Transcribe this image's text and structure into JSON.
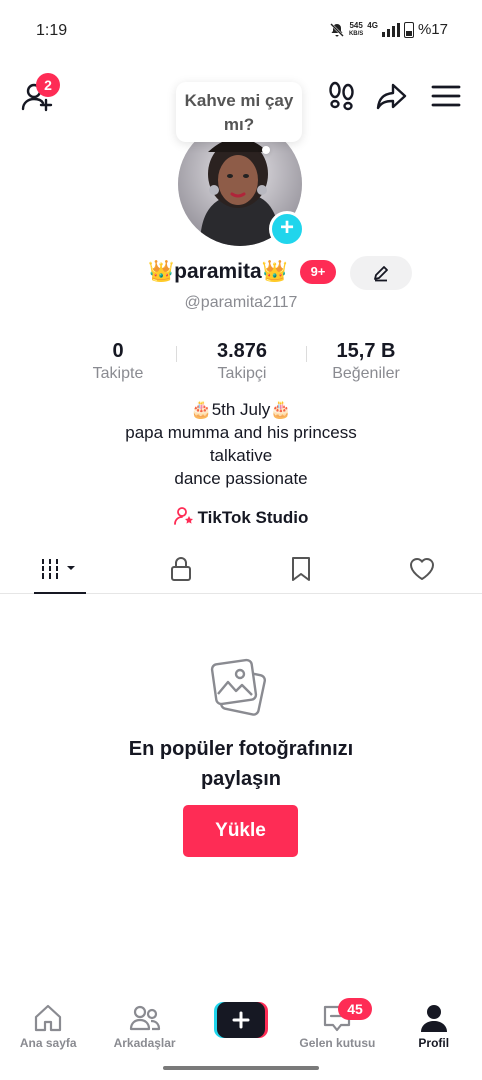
{
  "status": {
    "time": "1:19",
    "speed_value": "545",
    "speed_unit": "KB/S",
    "network": "4G",
    "battery": "%17"
  },
  "header": {
    "friends_badge": "2"
  },
  "bubble": {
    "text": "Kahve mi çay mı?"
  },
  "profile": {
    "name": "👑paramita👑",
    "name_badge": "9+",
    "handle": "@paramita2117"
  },
  "stats": [
    {
      "value": "0",
      "label": "Takipte"
    },
    {
      "value": "3.876",
      "label": "Takipçi"
    },
    {
      "value": "15,7 B",
      "label": "Beğeniler"
    }
  ],
  "bio": {
    "line1": "🎂5th July🎂",
    "line2": "papa mumma and his princess",
    "line3": "talkative",
    "line4": "dance passionate"
  },
  "studio_label": "TikTok Studio",
  "empty": {
    "title": "En popüler fotoğrafınızı paylaşın",
    "button": "Yükle"
  },
  "nav": {
    "home": "Ana sayfa",
    "friends": "Arkadaşlar",
    "inbox": "Gelen kutusu",
    "inbox_badge": "45",
    "profile": "Profil"
  },
  "colors": {
    "accent": "#fe2c55",
    "cyan": "#20d5ec",
    "text": "#161823",
    "muted": "#8a8b91"
  }
}
